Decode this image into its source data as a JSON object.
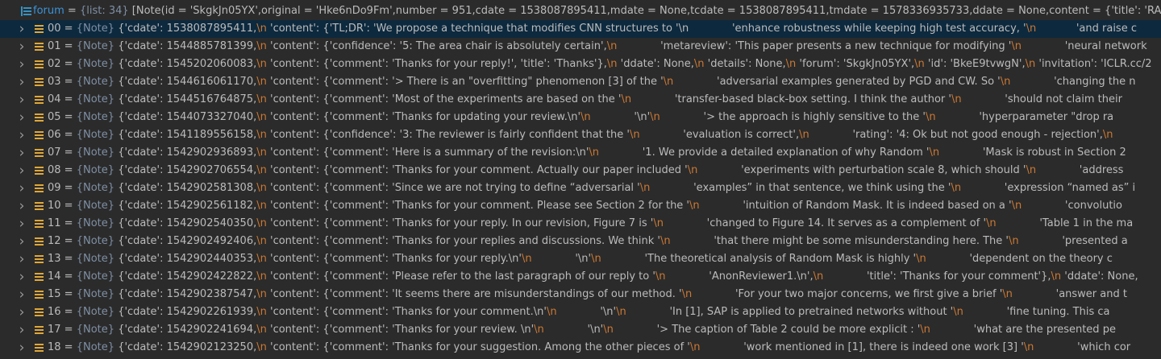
{
  "forum": {
    "name": "forum",
    "type": "{list: 34}",
    "value": "[Note(id = 'SkgkJn05YX',original = 'Hke6nDo9Fm',number = 951,cdate = 1538087895411,mdate = None,tcdate = 1538087895411,tmdate = 1578336935733,ddate = None,content = {'title': 'RAND"
  },
  "items": [
    {
      "index": "00",
      "type": "{Note}",
      "segments": [
        "{'cdate': 1538087895411,",
        "\\n",
        " 'content': {'TL;DR': 'We propose a technique that modifies CNN structures to ",
        "'\\n",
        "             'enhance robustness while keeping high test accuracy, '",
        "\\n",
        "            'and raise c"
      ]
    },
    {
      "index": "01",
      "type": "{Note}",
      "segments": [
        "{'cdate': 1544885781399,",
        "\\n",
        " 'content': {'confidence': '5: The area chair is absolutely certain',",
        "\\n",
        "             'metareview': 'This paper presents a new technique for modifying '",
        "\\n",
        "             'neural network"
      ]
    },
    {
      "index": "02",
      "type": "{Note}",
      "segments": [
        "{'cdate': 1545202060083,",
        "\\n",
        " 'content': {'comment': 'Thanks for your reply!', 'title': 'Thanks'},",
        "\\n",
        " 'ddate': None,",
        "\\n",
        " 'details': None,",
        "\\n",
        " 'forum': 'SkgkJn05YX',",
        "\\n",
        " 'id': 'BkeE9tvwgN',",
        "\\n",
        " 'invitation': 'ICLR.cc/2"
      ]
    },
    {
      "index": "03",
      "type": "{Note}",
      "segments": [
        "{'cdate': 1544616061170,",
        "\\n",
        " 'content': {'comment': '> There is an \"overfitting\" phenomenon [3] of the '",
        "\\n",
        "             'adversarial examples generated by PGD and CW. So '",
        "\\n",
        "             'changing the n"
      ]
    },
    {
      "index": "04",
      "type": "{Note}",
      "segments": [
        "{'cdate': 1544516764875,",
        "\\n",
        " 'content': {'comment': 'Most of the experiments are based on the '",
        "\\n",
        "             'transfer-based black-box setting. I think the author '",
        "\\n",
        "             'should not claim their"
      ]
    },
    {
      "index": "05",
      "type": "{Note}",
      "segments": [
        "{'cdate': 1544073327040,",
        "\\n",
        " 'content': {'comment': 'Thanks for updating your review.\\n'",
        "\\n",
        "             '\\n'",
        "\\n",
        "             '> the approach is highly sensitive to the '",
        "\\n",
        "             'hyperparameter \"drop ra"
      ]
    },
    {
      "index": "06",
      "type": "{Note}",
      "segments": [
        "{'cdate': 1541189556158,",
        "\\n",
        " 'content': {'confidence': '3: The reviewer is fairly confident that the '",
        "\\n",
        "             'evaluation is correct',",
        "\\n",
        "             'rating': '4: Ok but not good enough - rejection',",
        "\\n",
        "       "
      ]
    },
    {
      "index": "07",
      "type": "{Note}",
      "segments": [
        "{'cdate': 1542902936893,",
        "\\n",
        " 'content': {'comment': 'Here is a summary of the revision:\\n'",
        "\\n",
        "             '1. We provide a detailed explanation of why Random '",
        "\\n",
        "             'Mask is robust in Section 2"
      ]
    },
    {
      "index": "08",
      "type": "{Note}",
      "segments": [
        "{'cdate': 1542902706554,",
        "\\n",
        " 'content': {'comment': 'Thanks for your comment. Actually our paper included '",
        "\\n",
        "             'experiments with perturbation scale 8, which should '",
        "\\n",
        "             'address"
      ]
    },
    {
      "index": "09",
      "type": "{Note}",
      "segments": [
        "{'cdate': 1542902581308,",
        "\\n",
        " 'content': {'comment': 'Since we are not trying to define “adversarial '",
        "\\n",
        "             'examples” in that sentence, we think using the '",
        "\\n",
        "             'expression “named as” i"
      ]
    },
    {
      "index": "10",
      "type": "{Note}",
      "segments": [
        "{'cdate': 1542902561182,",
        "\\n",
        " 'content': {'comment': 'Thanks for your comment. Please see Section 2 for the '",
        "\\n",
        "             'intuition of Random Mask. It is indeed based on a '",
        "\\n",
        "             'convolutio"
      ]
    },
    {
      "index": "11",
      "type": "{Note}",
      "segments": [
        "{'cdate': 1542902540350,",
        "\\n",
        " 'content': {'comment': 'Thanks for your reply. In our revision, Figure 7 is '",
        "\\n",
        "             'changed to Figure 14. It serves as a complement of '",
        "\\n",
        "             'Table 1 in the ma"
      ]
    },
    {
      "index": "12",
      "type": "{Note}",
      "segments": [
        "{'cdate': 1542902492406,",
        "\\n",
        " 'content': {'comment': 'Thanks for your replies and discussions. We think '",
        "\\n",
        "             'that there might be some misunderstanding here. The '",
        "\\n",
        "             'presented a"
      ]
    },
    {
      "index": "13",
      "type": "{Note}",
      "segments": [
        "{'cdate': 1542902440353,",
        "\\n",
        " 'content': {'comment': 'Thanks for your reply.\\n'",
        "\\n",
        "             '\\n'",
        "\\n",
        "             'The theoretical analysis of Random Mask is highly '",
        "\\n",
        "             'dependent on the theory c"
      ]
    },
    {
      "index": "14",
      "type": "{Note}",
      "segments": [
        "{'cdate': 1542902422822,",
        "\\n",
        " 'content': {'comment': 'Please refer to the last paragraph of our reply to '",
        "\\n",
        "             'AnonReviewer1.\\n',",
        "\\n",
        "             'title': 'Thanks for your comment'},",
        "\\n",
        " 'ddate': None,"
      ]
    },
    {
      "index": "15",
      "type": "{Note}",
      "segments": [
        "{'cdate': 1542902387547,",
        "\\n",
        " 'content': {'comment': 'It seems there are misunderstandings of our method. '",
        "\\n",
        "             'For your two major concerns, we first give a brief '",
        "\\n",
        "             'answer and t"
      ]
    },
    {
      "index": "16",
      "type": "{Note}",
      "segments": [
        "{'cdate': 1542902261939,",
        "\\n",
        " 'content': {'comment': 'Thanks for your comment.\\n'",
        "\\n",
        "             '\\n'",
        "\\n",
        "             'In [1], SAP is applied to pretrained networks without '",
        "\\n",
        "             'fine tuning. This ca"
      ]
    },
    {
      "index": "17",
      "type": "{Note}",
      "segments": [
        "{'cdate': 1542902241694,",
        "\\n",
        " 'content': {'comment': 'Thanks for your review. \\n'",
        "\\n",
        "             '\\n'",
        "\\n",
        "             '> The caption of Table 2 could be more explicit : '",
        "\\n",
        "             'what are the presented pe"
      ]
    },
    {
      "index": "18",
      "type": "{Note}",
      "segments": [
        "{'cdate': 1542902123250,",
        "\\n",
        " 'content': {'comment': 'Thanks for your suggestion. Among the other pieces of '",
        "\\n",
        "             'work mentioned in [1], there is indeed one work [3] '",
        "\\n",
        "             'which cor"
      ]
    }
  ],
  "icons": {
    "expanded": "chevron-down-icon",
    "collapsed": "chevron-right-icon",
    "list": "list-variable-icon",
    "note": "note-object-icon"
  },
  "colors": {
    "background": "#2b2b2b",
    "selected_row": "#0d293e",
    "variable_name": "#3a93d8",
    "type_hint": "#7f8fa4",
    "escape_sequence": "#cc7832",
    "text": "#bbbbbb"
  }
}
